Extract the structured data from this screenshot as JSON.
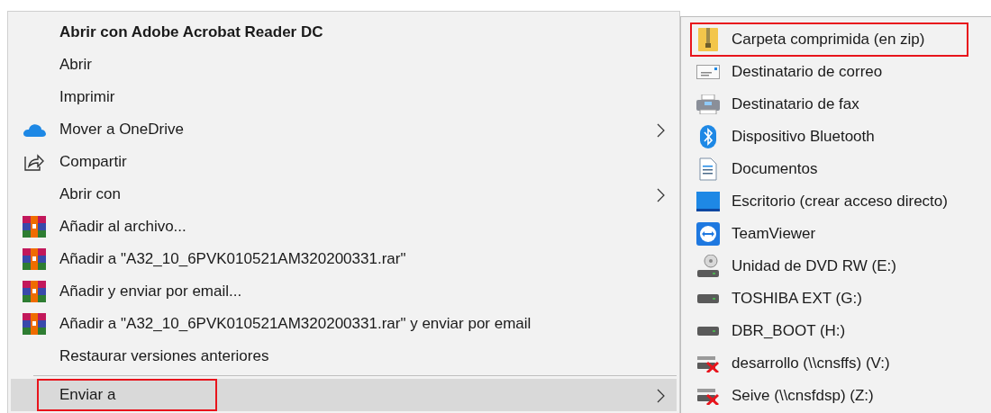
{
  "context_menu": {
    "items": [
      {
        "label": "Abrir con Adobe Acrobat Reader DC",
        "kind": "plain",
        "bold": true,
        "submenu": false,
        "selected": false,
        "outlined": false
      },
      {
        "label": "Abrir",
        "kind": "plain",
        "bold": false,
        "submenu": false,
        "selected": false,
        "outlined": false
      },
      {
        "label": "Imprimir",
        "kind": "plain",
        "bold": false,
        "submenu": false,
        "selected": false,
        "outlined": false
      },
      {
        "label": "Mover a OneDrive",
        "kind": "cloud",
        "bold": false,
        "submenu": true,
        "selected": false,
        "outlined": false
      },
      {
        "label": "Compartir",
        "kind": "share",
        "bold": false,
        "submenu": false,
        "selected": false,
        "outlined": false
      },
      {
        "label": "Abrir con",
        "kind": "plain",
        "bold": false,
        "submenu": true,
        "selected": false,
        "outlined": false
      },
      {
        "label": "Añadir al archivo...",
        "kind": "archive",
        "bold": false,
        "submenu": false,
        "selected": false,
        "outlined": false
      },
      {
        "label": "Añadir a \"A32_10_6PVK010521AM320200331.rar\"",
        "kind": "archive",
        "bold": false,
        "submenu": false,
        "selected": false,
        "outlined": false
      },
      {
        "label": "Añadir y enviar por email...",
        "kind": "archive",
        "bold": false,
        "submenu": false,
        "selected": false,
        "outlined": false
      },
      {
        "label": "Añadir a \"A32_10_6PVK010521AM320200331.rar\" y enviar por email",
        "kind": "archive",
        "bold": false,
        "submenu": false,
        "selected": false,
        "outlined": false
      },
      {
        "label": "Restaurar versiones anteriores",
        "kind": "plain",
        "bold": false,
        "submenu": false,
        "selected": false,
        "outlined": false
      },
      {
        "kind": "separator"
      },
      {
        "label": "Enviar a",
        "kind": "plain",
        "bold": false,
        "submenu": true,
        "selected": true,
        "outlined": true
      }
    ]
  },
  "send_to_menu": {
    "items": [
      {
        "label": "Carpeta comprimida (en zip)",
        "kind": "zip",
        "outlined": true
      },
      {
        "label": "Destinatario de correo",
        "kind": "mail",
        "outlined": false
      },
      {
        "label": "Destinatario de fax",
        "kind": "fax",
        "outlined": false
      },
      {
        "label": "Dispositivo Bluetooth",
        "kind": "bluetooth",
        "outlined": false
      },
      {
        "label": "Documentos",
        "kind": "document",
        "outlined": false
      },
      {
        "label": "Escritorio (crear acceso directo)",
        "kind": "desktop",
        "outlined": false
      },
      {
        "label": "TeamViewer",
        "kind": "teamviewer",
        "outlined": false
      },
      {
        "label": "Unidad de DVD RW (E:)",
        "kind": "dvd",
        "outlined": false
      },
      {
        "label": "TOSHIBA EXT (G:)",
        "kind": "drive",
        "outlined": false
      },
      {
        "label": "DBR_BOOT (H:)",
        "kind": "drive",
        "outlined": false
      },
      {
        "label": "desarrollo (\\\\cnsffs) (V:)",
        "kind": "netdrive",
        "outlined": false
      },
      {
        "label": "Seive (\\\\cnsfdsp) (Z:)",
        "kind": "netdrive",
        "outlined": false
      }
    ]
  }
}
